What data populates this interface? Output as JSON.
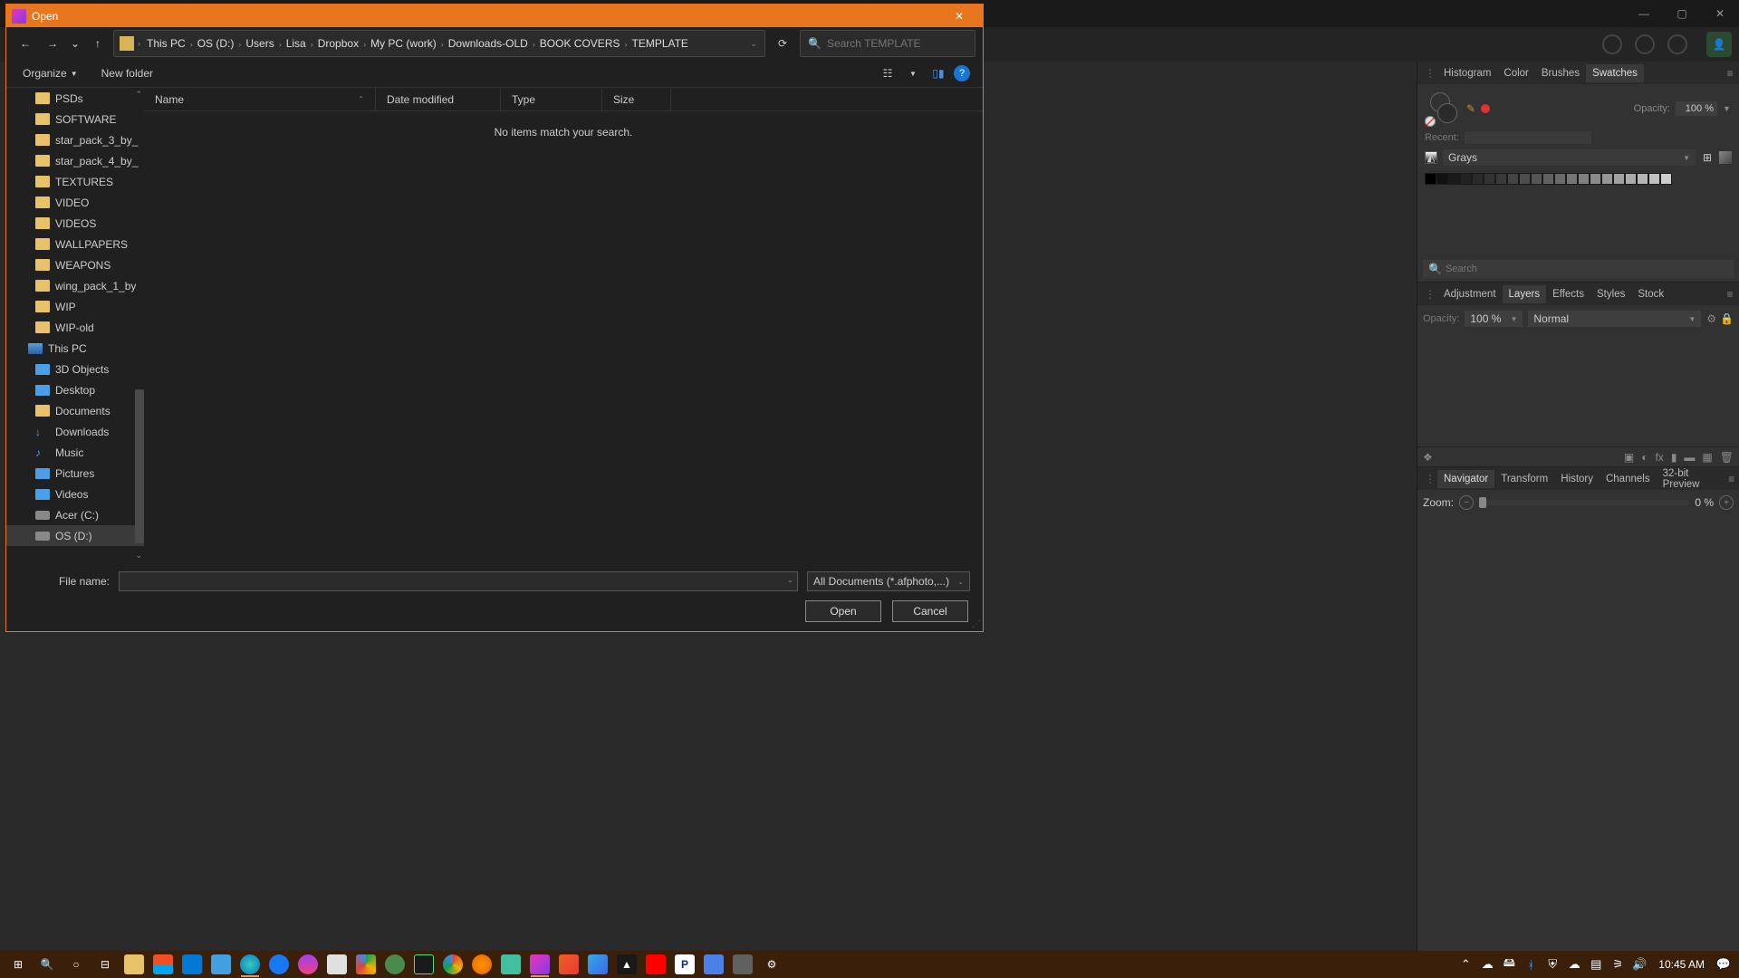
{
  "app": {
    "min": "—",
    "max": "▢",
    "close": "✕"
  },
  "rightPanels": {
    "group1": {
      "tabs": [
        "Histogram",
        "Color",
        "Brushes",
        "Swatches"
      ],
      "active": 3,
      "opacityLabel": "Opacity:",
      "opacityValue": "100 %",
      "recentLabel": "Recent:",
      "paletteName": "Grays",
      "searchPlaceholder": "Search"
    },
    "group2": {
      "tabs": [
        "Adjustment",
        "Layers",
        "Effects",
        "Styles",
        "Stock"
      ],
      "active": 1,
      "opacityLabel": "Opacity:",
      "opacityValue": "100 %",
      "blendMode": "Normal"
    },
    "group3": {
      "tabs": [
        "Navigator",
        "Transform",
        "History",
        "Channels",
        "32-bit Preview"
      ],
      "active": 0,
      "zoomLabel": "Zoom:",
      "zoomValue": "0 %"
    }
  },
  "dialog": {
    "title": "Open",
    "breadcrumbs": [
      "This PC",
      "OS (D:)",
      "Users",
      "Lisa",
      "Dropbox",
      "My PC (work)",
      "Downloads-OLD",
      "BOOK COVERS",
      "TEMPLATE"
    ],
    "searchPlaceholder": "Search TEMPLATE",
    "organize": "Organize",
    "newFolder": "New folder",
    "columns": {
      "name": "Name",
      "date": "Date modified",
      "type": "Type",
      "size": "Size"
    },
    "emptyMsg": "No items match your search.",
    "tree": [
      {
        "label": "PSDs",
        "icon": "folder"
      },
      {
        "label": "SOFTWARE",
        "icon": "folder"
      },
      {
        "label": "star_pack_3_by_",
        "icon": "folder"
      },
      {
        "label": "star_pack_4_by_",
        "icon": "folder"
      },
      {
        "label": "TEXTURES",
        "icon": "folder"
      },
      {
        "label": "VIDEO",
        "icon": "folder"
      },
      {
        "label": "VIDEOS",
        "icon": "folder"
      },
      {
        "label": "WALLPAPERS",
        "icon": "folder"
      },
      {
        "label": "WEAPONS",
        "icon": "folder"
      },
      {
        "label": "wing_pack_1_by",
        "icon": "folder"
      },
      {
        "label": "WIP",
        "icon": "folder"
      },
      {
        "label": "WIP-old",
        "icon": "folder"
      },
      {
        "label": "This PC",
        "icon": "pc",
        "root": true
      },
      {
        "label": "3D Objects",
        "icon": "obj",
        "sub": true
      },
      {
        "label": "Desktop",
        "icon": "pic",
        "sub": true
      },
      {
        "label": "Documents",
        "icon": "folder",
        "sub": true
      },
      {
        "label": "Downloads",
        "icon": "dl",
        "sub": true
      },
      {
        "label": "Music",
        "icon": "music",
        "sub": true
      },
      {
        "label": "Pictures",
        "icon": "pic",
        "sub": true
      },
      {
        "label": "Videos",
        "icon": "vid",
        "sub": true
      },
      {
        "label": "Acer (C:)",
        "icon": "drive",
        "sub": true
      },
      {
        "label": "OS (D:)",
        "icon": "drive",
        "sub": true,
        "sel": true
      }
    ],
    "fileNameLabel": "File name:",
    "fileType": "All Documents (*.afphoto,...)",
    "openBtn": "Open",
    "cancelBtn": "Cancel"
  },
  "taskbar": {
    "time": "10:45 AM"
  },
  "grays": [
    "#000",
    "#111",
    "#1a1a1a",
    "#222",
    "#2a2a2a",
    "#333",
    "#3a3a3a",
    "#444",
    "#4d4d4d",
    "#555",
    "#606060",
    "#6a6a6a",
    "#757575",
    "#808080",
    "#8a8a8a",
    "#959595",
    "#a0a0a0",
    "#aaa",
    "#b5b5b5",
    "#c0c0c0",
    "#ccc"
  ]
}
